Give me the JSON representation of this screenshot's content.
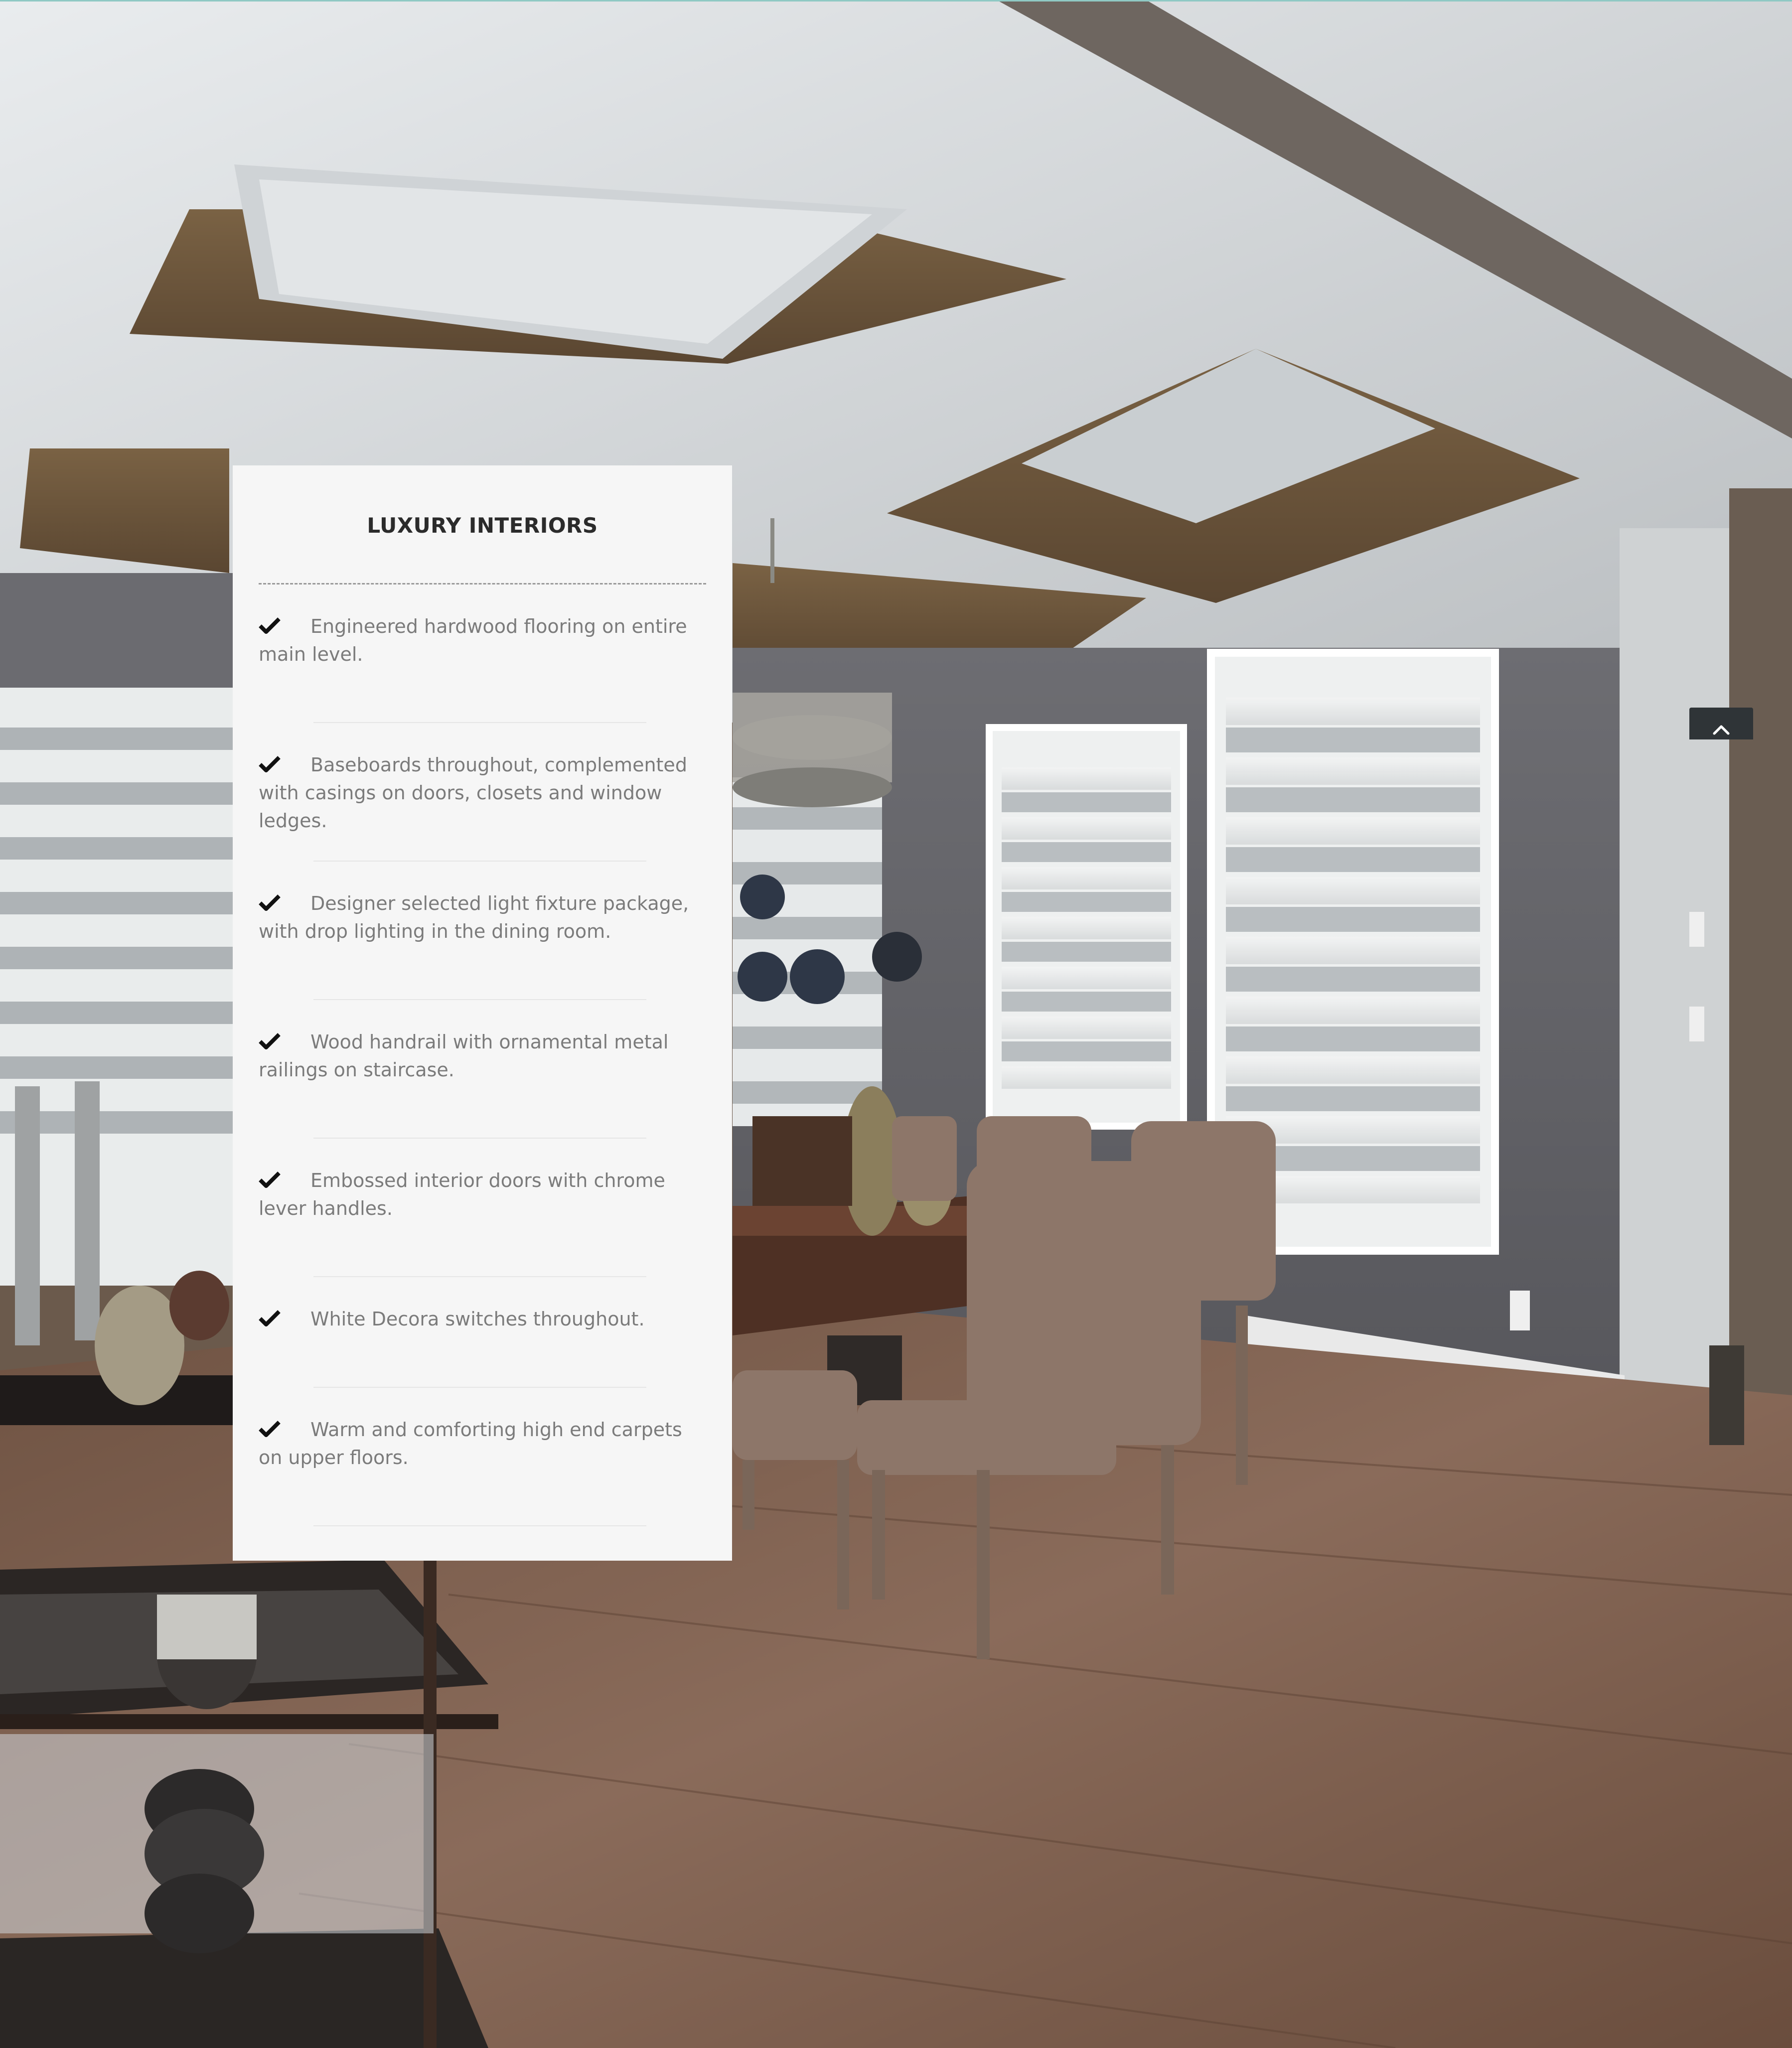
{
  "panel": {
    "title": "LUXURY INTERIORS",
    "features": [
      {
        "text": "Engineered hardwood flooring on entire main level."
      },
      {
        "text": "Baseboards throughout, complemented with casings on doors, closets and window ledges."
      },
      {
        "text": "Designer selected light fixture package, with drop lighting in the dining room."
      },
      {
        "text": "Wood handrail with ornamental metal railings on staircase."
      },
      {
        "text": "Embossed interior doors with chrome lever handles."
      },
      {
        "text": "White Decora switches throughout."
      },
      {
        "text": "Warm and comforting high end carpets on upper floors."
      }
    ]
  },
  "icons": {
    "feature_bullet": "checkmark-icon",
    "scroll_top": "chevron-up-icon"
  },
  "colors": {
    "panel_bg": "#f6f6f6",
    "title_text": "#2b2b2b",
    "body_text": "#7b7b7b",
    "accent_top_rule": "#8fc9c4",
    "scroll_top_bg": "#2f3437"
  }
}
